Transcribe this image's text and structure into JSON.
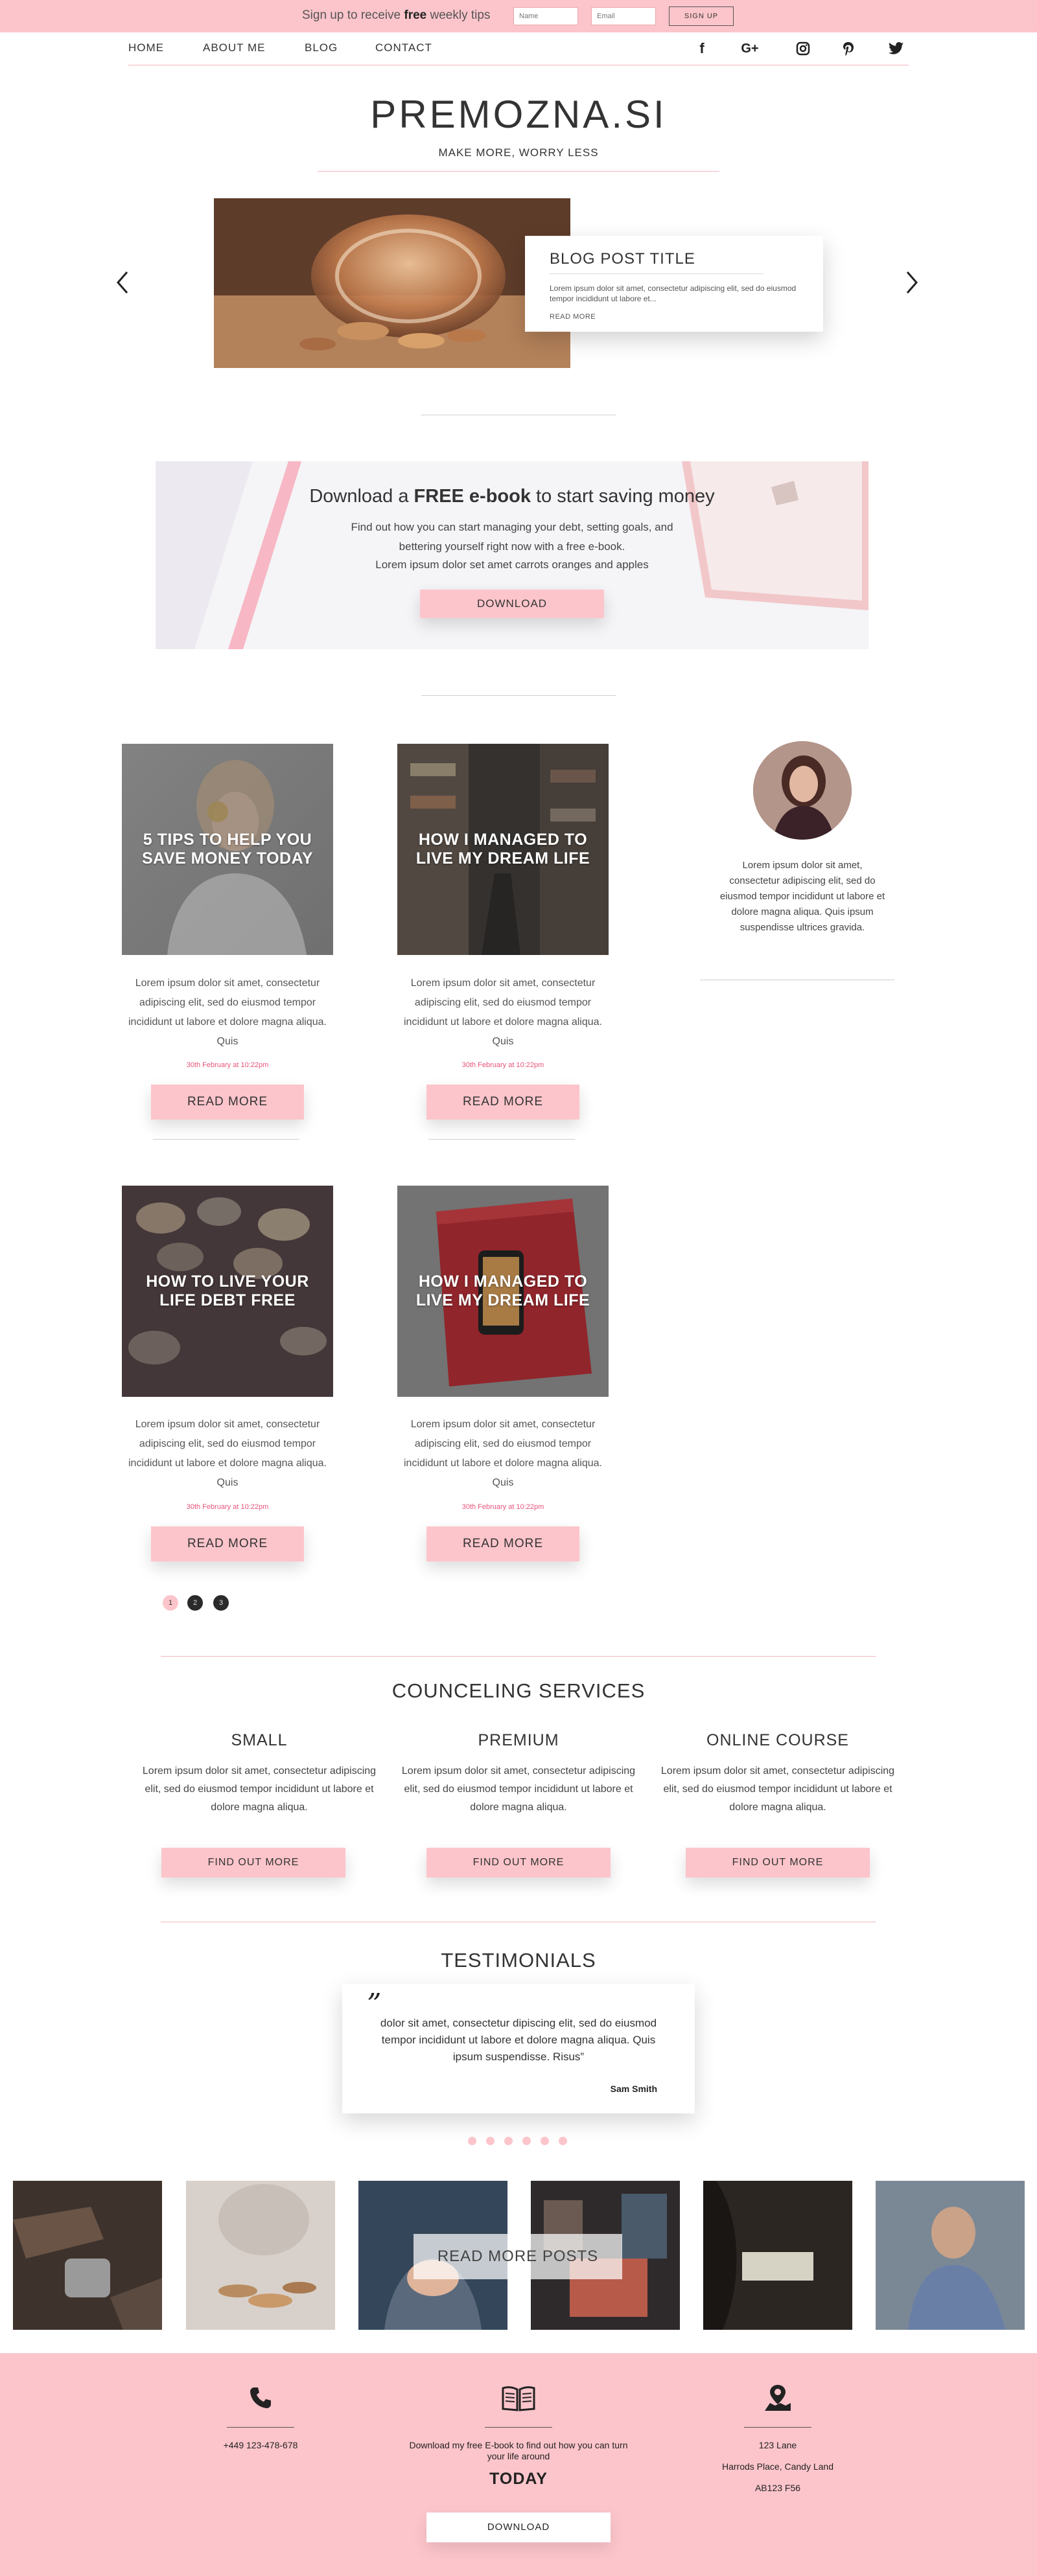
{
  "signup_bar": {
    "text_pre": "Sign up to receive ",
    "text_bold": "free",
    "text_post": " weekly tips",
    "name_placeholder": "Name",
    "email_placeholder": "Email",
    "button": "SIGN UP"
  },
  "nav": {
    "items": [
      "HOME",
      "ABOUT ME",
      "BLOG",
      "CONTACT"
    ],
    "social_icons": [
      "facebook-icon",
      "google-plus-icon",
      "instagram-icon",
      "pinterest-icon",
      "twitter-icon"
    ]
  },
  "header": {
    "title": "PREMOZNA.SI",
    "tagline": "MAKE MORE, WORRY LESS"
  },
  "slider": {
    "title": "BLOG POST TITLE",
    "excerpt": "Lorem ipsum dolor sit amet, consectetur adipiscing elit, sed do eiusmod tempor incididunt ut labore et...",
    "read_more": "READ MORE"
  },
  "ebook": {
    "title_pre": "Download a ",
    "title_bold": "FREE e-book",
    "title_post": " to start saving money",
    "lines": [
      "Find out how you can start managing your debt, setting goals, and",
      "bettering yourself right now with a free e-book.",
      "Lorem ipsum dolor set amet carrots oranges and apples"
    ],
    "button": "DOWNLOAD"
  },
  "posts": [
    {
      "title": "5 TIPS TO HELP YOU SAVE MONEY TODAY",
      "excerpt": "Lorem ipsum dolor sit amet, consectetur adipiscing elit, sed do eiusmod tempor incididunt ut labore et dolore magna aliqua. Quis",
      "date": "30th February at 10:22pm",
      "button": "READ MORE"
    },
    {
      "title": "HOW I MANAGED TO LIVE MY DREAM LIFE",
      "excerpt": "Lorem ipsum dolor sit amet, consectetur adipiscing elit, sed do eiusmod tempor incididunt ut labore et dolore magna aliqua. Quis",
      "date": "30th February at 10:22pm",
      "button": "READ MORE"
    },
    {
      "title": "HOW TO LIVE YOUR LIFE DEBT FREE",
      "excerpt": "Lorem ipsum dolor sit amet, consectetur adipiscing elit, sed do eiusmod tempor incididunt ut labore et dolore magna aliqua. Quis",
      "date": "30th February at 10:22pm",
      "button": "READ MORE"
    },
    {
      "title": "HOW I MANAGED TO LIVE MY DREAM LIFE",
      "excerpt": "Lorem ipsum dolor sit amet, consectetur adipiscing elit, sed do eiusmod tempor incididunt ut labore et dolore magna aliqua. Quis",
      "date": "30th February at 10:22pm",
      "button": "READ MORE"
    }
  ],
  "author": {
    "bio": "Lorem ipsum dolor sit amet, consectetur adipiscing elit, sed do eiusmod tempor incididunt ut labore et dolore magna aliqua. Quis ipsum suspendisse ultrices gravida."
  },
  "pagination": {
    "pages": [
      "1",
      "2",
      "3"
    ],
    "current": "1"
  },
  "services": {
    "heading": "COUNCELING SERVICES",
    "items": [
      {
        "name": "SMALL",
        "desc": "Lorem ipsum dolor sit amet, consectetur adipiscing elit, sed do eiusmod tempor incididunt ut labore et dolore magna aliqua.",
        "button": "FIND OUT MORE"
      },
      {
        "name": "PREMIUM",
        "desc": "Lorem ipsum dolor sit amet, consectetur adipiscing elit, sed do eiusmod tempor incididunt ut labore et dolore magna aliqua.",
        "button": "FIND OUT MORE"
      },
      {
        "name": "ONLINE COURSE",
        "desc": "Lorem ipsum dolor sit amet, consectetur adipiscing elit, sed do eiusmod tempor incididunt ut labore et dolore magna aliqua.",
        "button": "FIND OUT MORE"
      }
    ]
  },
  "testimonials": {
    "heading": "TESTIMONIALS",
    "quote_mark": "”",
    "text": "dolor sit amet, consectetur dipiscing elit, sed do eiusmod tempor incididunt ut labore et dolore magna aliqua. Quis ipsum suspendisse. Risus”",
    "author": "Sam Smith"
  },
  "instagram": {
    "button": "READ MORE POSTS"
  },
  "footer": {
    "phone": "+449 123-478-678",
    "ebook_text": "Download my free E-book to find out how you can turn your life around",
    "today": "TODAY",
    "button": "DOWNLOAD",
    "address_lines": [
      "123 Lane",
      "Harrods Place, Candy Land",
      "AB123 F56"
    ]
  },
  "colors": {
    "accent_pink": "#fcc5cb",
    "date_pink": "#e8547a",
    "text_dark": "#333333"
  }
}
